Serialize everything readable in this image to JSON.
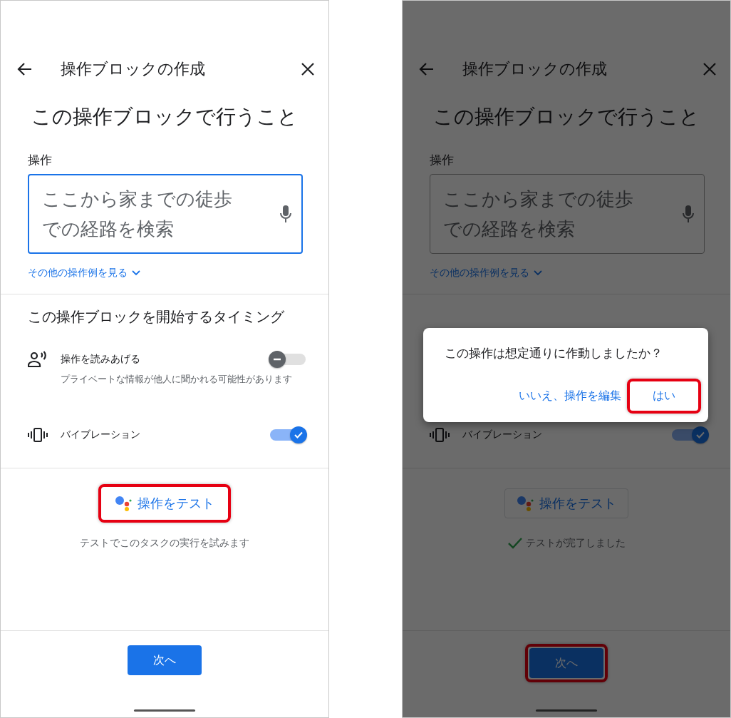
{
  "screens": [
    {
      "dimmed": false,
      "title": "操作ブロックの作成",
      "heading": "この操作ブロックで行うこと",
      "field": {
        "label": "操作",
        "value": "ここから家までの徒歩での経路を検索",
        "focused": true
      },
      "examples_link": "その他の操作例を見る",
      "timing_heading": "この操作ブロックを開始するタイミング",
      "options": [
        {
          "kind": "speak",
          "label": "操作を読みあげる",
          "description": "プライベートな情報が他人に聞かれる可能性があります",
          "on": false
        },
        {
          "kind": "vibrate",
          "label": "バイブレーション",
          "on": true
        }
      ],
      "test_button": {
        "label": "操作をテスト",
        "highlighted": true
      },
      "test_note": {
        "text": "テストでこのタスクの実行を試みます",
        "done": false
      },
      "next_button": {
        "label": "次へ",
        "highlighted": false
      }
    },
    {
      "dimmed": true,
      "title": "操作ブロックの作成",
      "heading": "この操作ブロックで行うこと",
      "field": {
        "label": "操作",
        "value": "ここから家までの徒歩での経路を検索",
        "focused": false
      },
      "examples_link": "その他の操作例を見る",
      "options": [
        {
          "kind": "vibrate",
          "label": "バイブレーション",
          "on": true
        }
      ],
      "test_button": {
        "label": "操作をテスト",
        "highlighted": false
      },
      "test_note": {
        "text": "テストが完了しました",
        "done": true
      },
      "next_button": {
        "label": "次へ",
        "highlighted": true
      },
      "dialog": {
        "message": "この操作は想定通りに作動しましたか？",
        "buttons": [
          {
            "label": "いいえ、操作を編集",
            "highlighted": false
          },
          {
            "label": "はい",
            "highlighted": true
          }
        ]
      }
    }
  ]
}
